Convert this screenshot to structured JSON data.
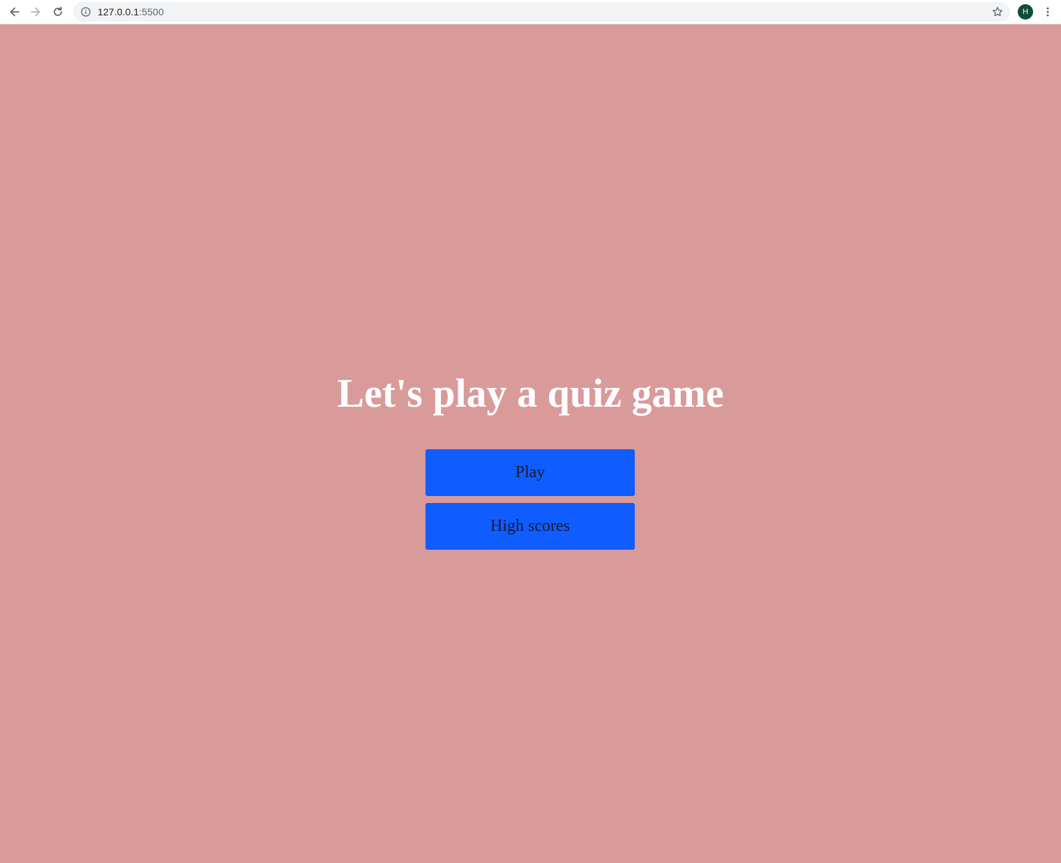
{
  "browser": {
    "url_host": "127.0.0.1",
    "url_port": ":5500",
    "profile_initial": "H"
  },
  "page": {
    "title": "Let's play a quiz game",
    "buttons": {
      "play_label": "Play",
      "high_scores_label": "High scores"
    }
  },
  "colors": {
    "background": "#d99a9a",
    "button": "#0f5cff",
    "title_text": "#ffffff",
    "avatar": "#0f4d3a"
  },
  "icons": [
    "back-arrow-icon",
    "forward-arrow-icon",
    "reload-icon",
    "info-icon",
    "star-icon",
    "kebab-menu-icon"
  ]
}
